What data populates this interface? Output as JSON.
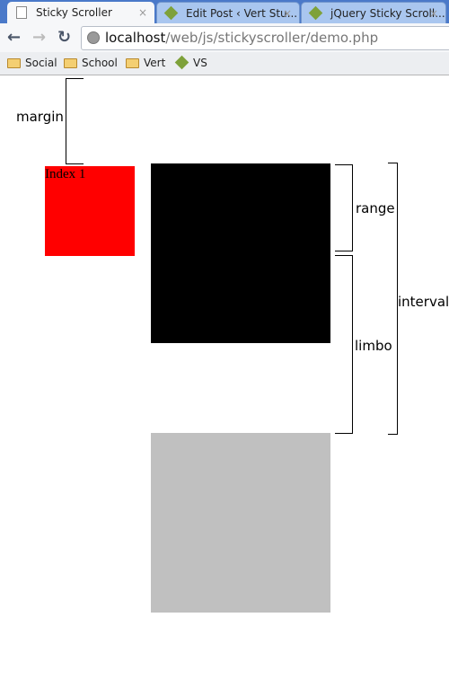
{
  "browser": {
    "tabs": [
      {
        "label": "Sticky Scroller",
        "active": true,
        "icon": "page-icon"
      },
      {
        "label": "Edit Post ‹ Vert Stu...",
        "active": false,
        "icon": "vs-icon"
      },
      {
        "label": "jQuery Sticky Scroll...",
        "active": false,
        "icon": "vs-icon"
      }
    ],
    "close_glyph": "×",
    "address": {
      "host": "localhost",
      "path": "/web/js/stickyscroller/demo.php"
    },
    "bookmarks": [
      {
        "label": "Social",
        "icon": "folder-icon"
      },
      {
        "label": "School",
        "icon": "folder-icon"
      },
      {
        "label": "Vert",
        "icon": "folder-icon"
      },
      {
        "label": "VS",
        "icon": "vs-icon"
      }
    ]
  },
  "demo": {
    "margin_label": "margin",
    "range_label": "range",
    "limbo_label": "limbo",
    "interval_label": "interval",
    "sticky_box_text": "Index 1",
    "colors": {
      "sticky": "#ff0000",
      "range_box": "#000000",
      "next_box": "#c0c0c0"
    }
  }
}
